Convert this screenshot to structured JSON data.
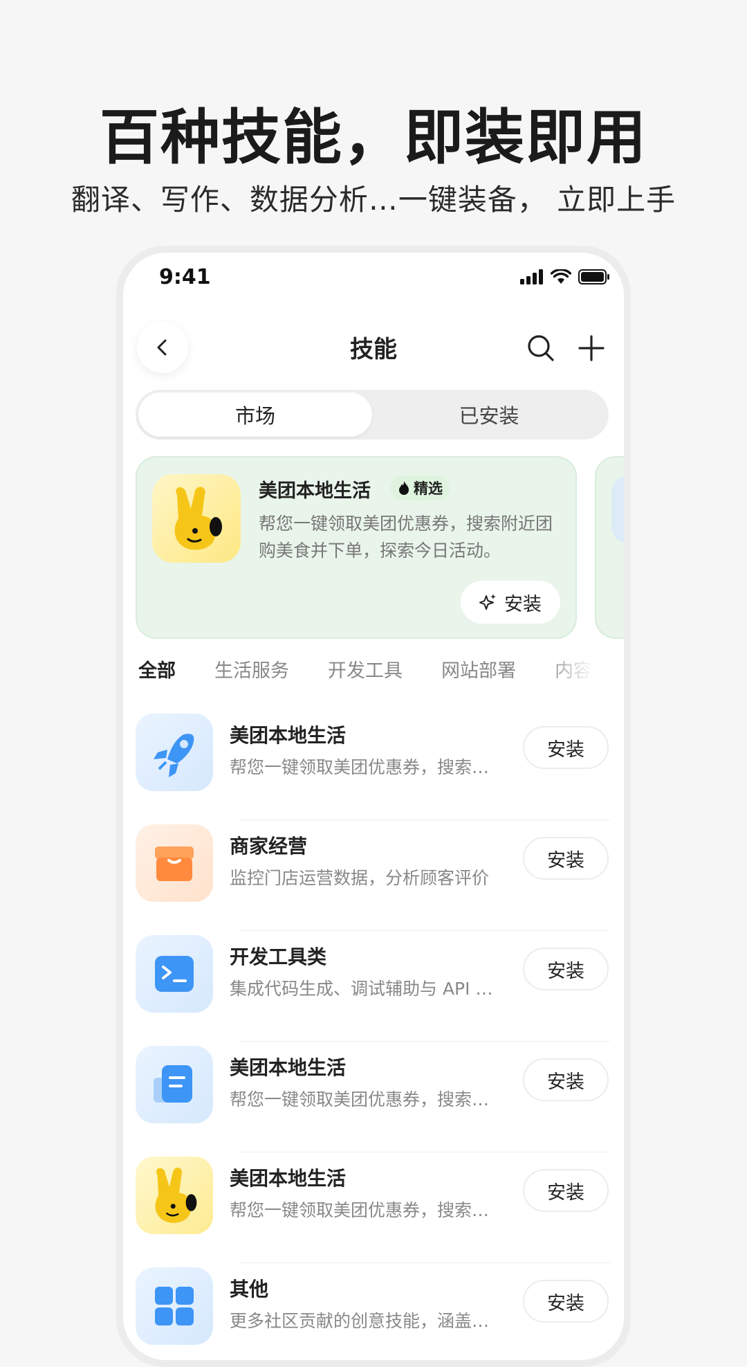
{
  "headline": "百种技能，即装即用",
  "subline": "翻译、写作、数据分析…一键装备， 立即上手",
  "status_bar": {
    "time": "9:41"
  },
  "nav": {
    "title": "技能"
  },
  "segments": {
    "market": "市场",
    "installed": "已安装"
  },
  "featured": {
    "title": "美团本地生活",
    "badge": "精选",
    "description": "帮您一键领取美团优惠券，搜索附近团购美食并下单，探索今日活动。",
    "install_label": "安装"
  },
  "categories": [
    "全部",
    "生活服务",
    "开发工具",
    "网站部署",
    "内容"
  ],
  "skills": [
    {
      "title": "美团本地生活",
      "description": "帮您一键领取美团优惠券，搜索附近团购美食并下单",
      "install_label": "安装",
      "icon": "rocket-icon"
    },
    {
      "title": "商家经营",
      "description": "监控门店运营数据，分析顾客评价",
      "install_label": "安装",
      "icon": "box-icon"
    },
    {
      "title": "开发工具类",
      "description": "集成代码生成、调试辅助与 API 工具",
      "install_label": "安装",
      "icon": "terminal-icon"
    },
    {
      "title": "美团本地生活",
      "description": "帮您一键领取美团优惠券，搜索附近团购美食并下单",
      "install_label": "安装",
      "icon": "document-icon"
    },
    {
      "title": "美团本地生活",
      "description": "帮您一键领取美团优惠券，搜索附近团购美食并下单",
      "install_label": "安装",
      "icon": "mascot-icon"
    },
    {
      "title": "其他",
      "description": "更多社区贡献的创意技能，涵盖多种场景",
      "install_label": "安装",
      "icon": "grid-icon"
    }
  ],
  "colors": {
    "featured_bg": "#e9f5ea",
    "accent_blue": "#3d95f5",
    "accent_orange": "#ff8a3d",
    "mascot_yellow": "#f5c518"
  }
}
